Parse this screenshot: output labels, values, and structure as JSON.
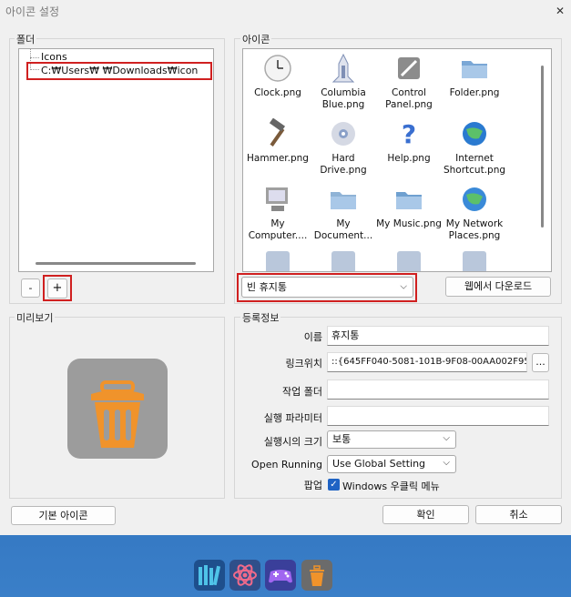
{
  "window": {
    "title": "아이콘 설정",
    "close_glyph": "✕"
  },
  "folder_group": {
    "label": "폴더",
    "tree": [
      {
        "label": "Icons"
      },
      {
        "label": "C:₩Users₩        ₩Downloads₩icon"
      }
    ],
    "remove_label": "-",
    "add_label": "+"
  },
  "icon_group": {
    "label": "아이콘",
    "icons": [
      {
        "label": "Clock.png",
        "icon": "clock-icon"
      },
      {
        "label": "Columbia Blue.png",
        "icon": "space-shuttle-icon"
      },
      {
        "label": "Control Panel.png",
        "icon": "control-panel-icon"
      },
      {
        "label": "Folder.png",
        "icon": "folder-icon"
      },
      {
        "label": "Hammer.png",
        "icon": "hammer-icon"
      },
      {
        "label": "Hard Drive.png",
        "icon": "hard-drive-icon"
      },
      {
        "label": "Help.png",
        "icon": "help-icon"
      },
      {
        "label": "Internet Shortcut.png",
        "icon": "globe-icon"
      },
      {
        "label": "My Computer....",
        "icon": "computer-icon"
      },
      {
        "label": "My Document...",
        "icon": "documents-folder-icon"
      },
      {
        "label": "My Music.png",
        "icon": "music-folder-icon"
      },
      {
        "label": "My Network Places.png",
        "icon": "network-globe-icon"
      }
    ],
    "selected_icon": "빈 휴지통",
    "download_label": "웹에서 다운로드"
  },
  "preview_group": {
    "label": "미리보기",
    "icon": "recycle-bin-icon",
    "colors": {
      "tile": "#9c9c9c",
      "bin": "#f0932b"
    }
  },
  "registration_group": {
    "label": "등록정보",
    "name_label": "이름",
    "name_value": "휴지통",
    "link_label": "링크위치",
    "link_value": "::{645FF040-5081-101B-9F08-00AA002F954",
    "browse_label": "...",
    "workdir_label": "작업 폴더",
    "workdir_value": "",
    "params_label": "실행 파라미터",
    "params_value": "",
    "size_label": "실행시의 크기",
    "size_value": "보통",
    "running_label": "Open Running",
    "running_value": "Use Global Setting",
    "popup_label": "팝업",
    "popup_checkbox_label": "Windows 우클릭 메뉴",
    "popup_checked": true
  },
  "footer": {
    "default_icon_label": "기본 아이콘",
    "ok_label": "확인",
    "cancel_label": "취소"
  },
  "taskbar": {
    "icons": [
      "books-icon",
      "atom-icon",
      "gamepad-icon",
      "recycle-bin-icon"
    ]
  }
}
